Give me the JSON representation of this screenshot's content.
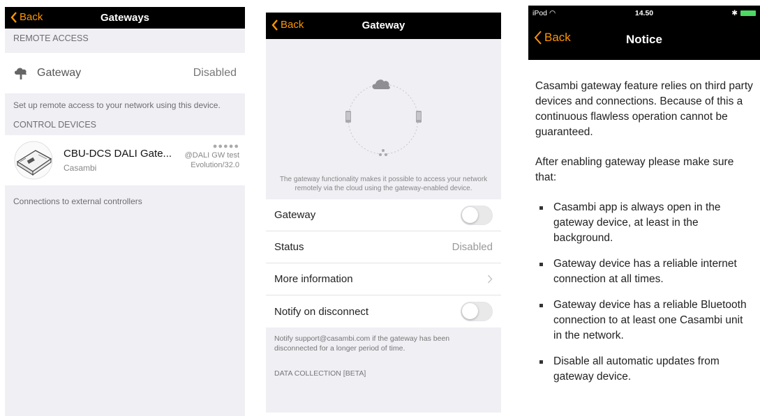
{
  "screen1": {
    "back_label": "Back",
    "title": "Gateways",
    "remote_access_header": "REMOTE ACCESS",
    "gateway_label": "Gateway",
    "gateway_value": "Disabled",
    "remote_footer": "Set up remote access to your network using this device.",
    "control_header": "CONTROL DEVICES",
    "device_name": "CBU-DCS DALI Gate...",
    "device_maker": "Casambi",
    "device_signal": "●●●●●",
    "device_network": "@DALI GW test",
    "device_firmware": "Evolution/32.0",
    "control_footer": "Connections to external controllers"
  },
  "screen2": {
    "back_label": "Back",
    "title": "Gateway",
    "description": "The gateway functionality makes it possible to access your network remotely via the cloud using the gateway-enabled device.",
    "gateway_label": "Gateway",
    "gateway_toggle": false,
    "status_label": "Status",
    "status_value": "Disabled",
    "more_info_label": "More information",
    "notify_label": "Notify on disconnect",
    "notify_toggle": false,
    "notify_footer": "Notify support@casambi.com if the gateway has been disconnected for a longer period of time.",
    "data_header": "DATA COLLECTION [BETA]"
  },
  "screen3": {
    "carrier": "iPod",
    "time": "14.50",
    "back_label": "Back",
    "title": "Notice",
    "para1": "Casambi gateway feature relies on third party devices and connections. Because of this a continuous flawless operation cannot be guaranteed.",
    "para2": "After enabling gateway please make sure that:",
    "bullets": [
      "Casambi app is always open in the gateway device, at least in the background.",
      "Gateway device has a reliable internet connection at all times.",
      "Gateway device has a reliable Bluetooth connection to at least one Casambi unit in the network.",
      "Disable all automatic updates from gateway device."
    ]
  },
  "colors": {
    "accent": "#ff9500",
    "navbar": "#000000",
    "background": "#efeff4",
    "battery": "#4cd964"
  }
}
